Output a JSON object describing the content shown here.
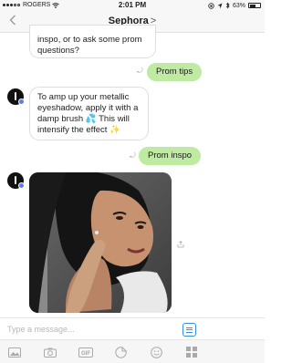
{
  "status_bar": {
    "carrier": "ROGERS",
    "time": "2:01 PM",
    "battery": "63%",
    "battery_level": 0.63
  },
  "header": {
    "title": "Sephora",
    "chevron": ">",
    "back_icon": "chevron-left-icon"
  },
  "messages": [
    {
      "from": "bot",
      "text": "inspo, or to ask some prom questions?"
    },
    {
      "from": "user",
      "text": "Prom tips"
    },
    {
      "from": "bot",
      "text": "To amp up your metallic eyeshadow, apply it with a damp brush 💦 This will intensify the effect ✨"
    },
    {
      "from": "user",
      "text": "Prom inspo"
    },
    {
      "from": "bot",
      "type": "image"
    }
  ],
  "compose": {
    "placeholder": "Type a message..."
  },
  "toolbar": {
    "icons": [
      "photo-icon",
      "camera-icon",
      "gif-icon",
      "sticker-icon",
      "emoji-icon",
      "apps-grid-icon"
    ],
    "gif_label": "GIF"
  },
  "colors": {
    "user_bubble": "#bfeaa2",
    "accent": "#3a8fd8",
    "bot_badge": "#5a7cf2"
  }
}
